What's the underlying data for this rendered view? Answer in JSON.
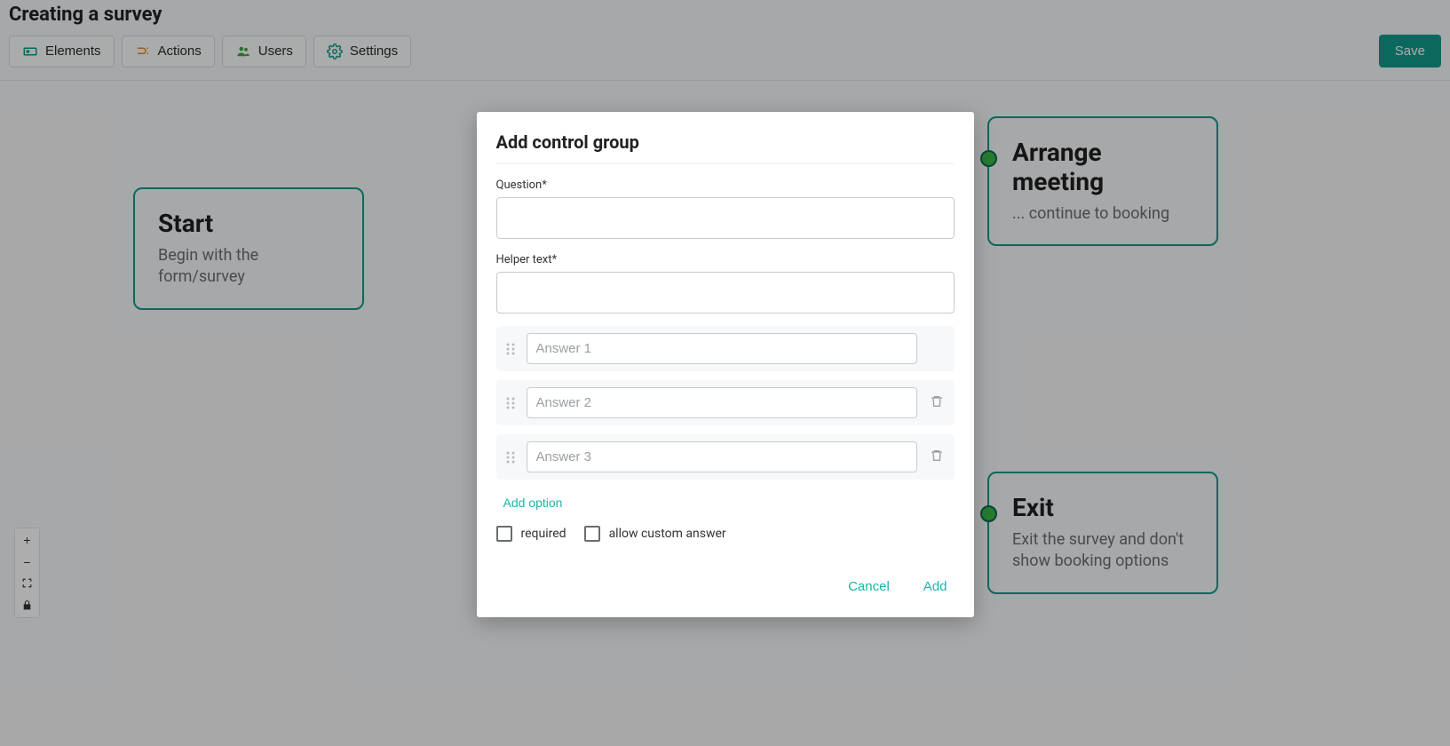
{
  "header": {
    "page_title": "Creating a survey",
    "buttons": {
      "elements": "Elements",
      "actions": "Actions",
      "users": "Users",
      "settings": "Settings",
      "save": "Save"
    }
  },
  "nodes": {
    "start": {
      "title": "Start",
      "subtitle": "Begin with the form/survey"
    },
    "arrange": {
      "title": "Arrange meeting",
      "subtitle": "... continue to booking"
    },
    "exit": {
      "title": "Exit",
      "subtitle": "Exit the survey and don't show booking options"
    }
  },
  "modal": {
    "title": "Add control group",
    "question_label": "Question*",
    "question_value": "",
    "helper_label": "Helper text*",
    "helper_value": "",
    "answers": [
      {
        "placeholder": "Answer 1",
        "deletable": false
      },
      {
        "placeholder": "Answer 2",
        "deletable": true
      },
      {
        "placeholder": "Answer 3",
        "deletable": true
      }
    ],
    "add_option": "Add option",
    "required_label": "required",
    "custom_label": "allow custom answer",
    "cancel": "Cancel",
    "add": "Add"
  }
}
